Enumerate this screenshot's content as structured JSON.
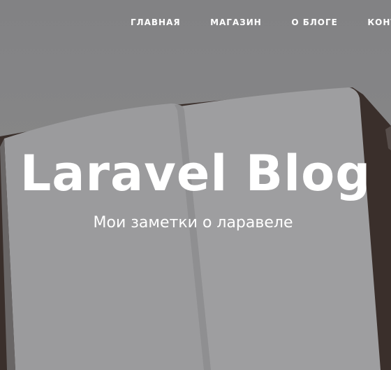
{
  "nav": {
    "items": [
      {
        "label": "ГЛАВНАЯ"
      },
      {
        "label": "МАГАЗИН"
      },
      {
        "label": "О БЛОГЕ"
      },
      {
        "label": "КОНТАКТЫ"
      }
    ]
  },
  "hero": {
    "title": "Laravel Blog",
    "subtitle": "Мои заметки о ларавеле"
  },
  "colors": {
    "text": "#ffffff",
    "background": "#8a8a8c",
    "page": "#a5a5a7",
    "notebook_edge": "#3a2e2a"
  }
}
